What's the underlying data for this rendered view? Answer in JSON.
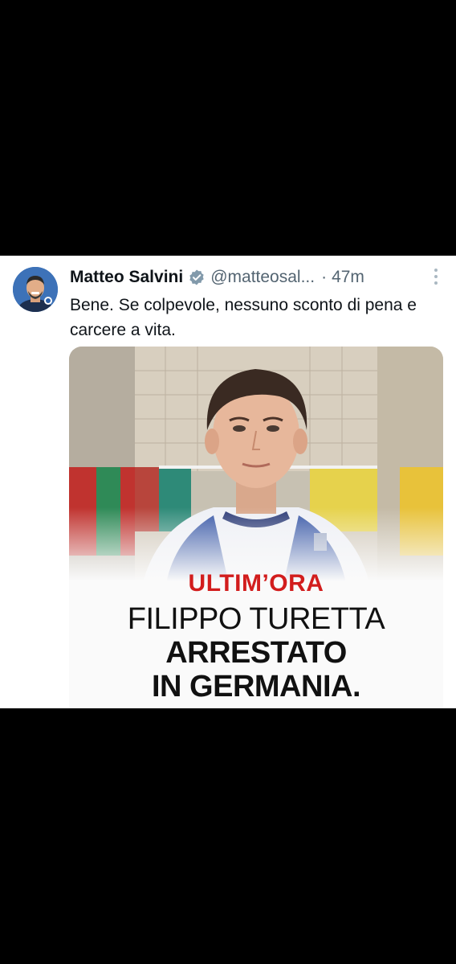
{
  "tweet": {
    "author_name": "Matteo Salvini",
    "handle": "@matteosal...",
    "separator": "·",
    "time": "47m",
    "text": "Bene. Se colpevole, nessuno sconto di pena e carcere a vita.",
    "verified_icon": "verified-badge-icon",
    "more_icon": "more-options-icon",
    "media": {
      "tag": "ULTIM’ORA",
      "line1": "FILIPPO TURETTA",
      "line2": "ARRESTATO",
      "line3": "IN GERMANIA."
    }
  },
  "colors": {
    "background": "#000000",
    "card": "#ffffff",
    "name": "#0f1419",
    "secondary": "#536471",
    "headline_red": "#d21d1d"
  }
}
